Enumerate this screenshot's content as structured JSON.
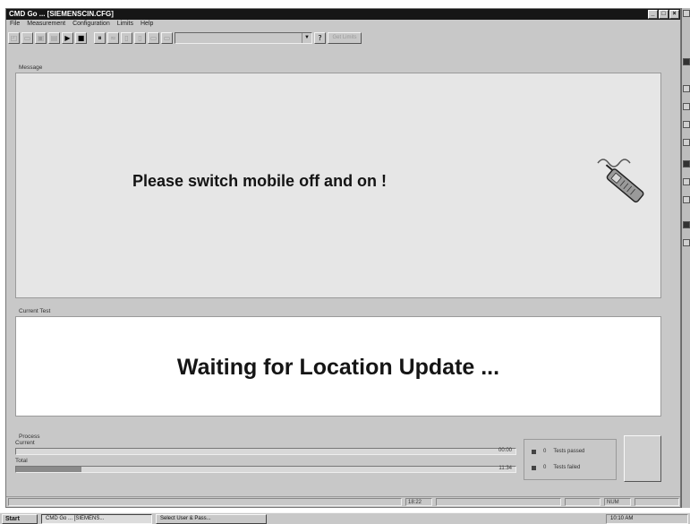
{
  "window": {
    "title": "CMD Go ... [SIEMENSCIN.CFG]",
    "controls": {
      "minimize": "_",
      "maximize": "□",
      "close": "×"
    }
  },
  "menu": [
    "File",
    "Measurement",
    "Configuration",
    "Limits",
    "Help"
  ],
  "toolbar": {
    "buttons": [
      "◰",
      "▭",
      "▣",
      "▤",
      "▶",
      "■",
      "⏸",
      "≈",
      "▯",
      "▯",
      "▭",
      "▭"
    ],
    "combo_value": "",
    "help_label": "?",
    "disabled_button_label": "Get Limits"
  },
  "message": {
    "group_label": "Message",
    "text": "Please switch mobile off and on !",
    "icon": "mobile-phone-icon"
  },
  "current_test": {
    "group_label": "Current Test",
    "text": "Waiting for Location Update ..."
  },
  "progress": {
    "group_label": "Process",
    "current": {
      "label": "Current",
      "value_text": "00:00",
      "fraction": 0.0
    },
    "total": {
      "label": "Total",
      "value_text": "11:34",
      "fraction": 0.13
    }
  },
  "stats": {
    "passed_label": "Tests passed",
    "passed_count": "0",
    "failed_label": "Tests failed",
    "failed_count": "0"
  },
  "big_button_label": "",
  "window_status": [
    "",
    "18:22",
    "",
    "",
    "NUM",
    ""
  ],
  "taskbar": {
    "start_label": "Start",
    "tasks": [
      {
        "label": "CMD Go ... [SIEMENS...",
        "active": true
      },
      {
        "label": "Select User & Pass...",
        "active": false
      }
    ],
    "tray_time": "10:10 AM"
  },
  "colors": {
    "titlebar": "#161616",
    "window_face": "#c8c8c8",
    "message_panel": "#e6e6e6",
    "status_panel": "#ffffff"
  }
}
